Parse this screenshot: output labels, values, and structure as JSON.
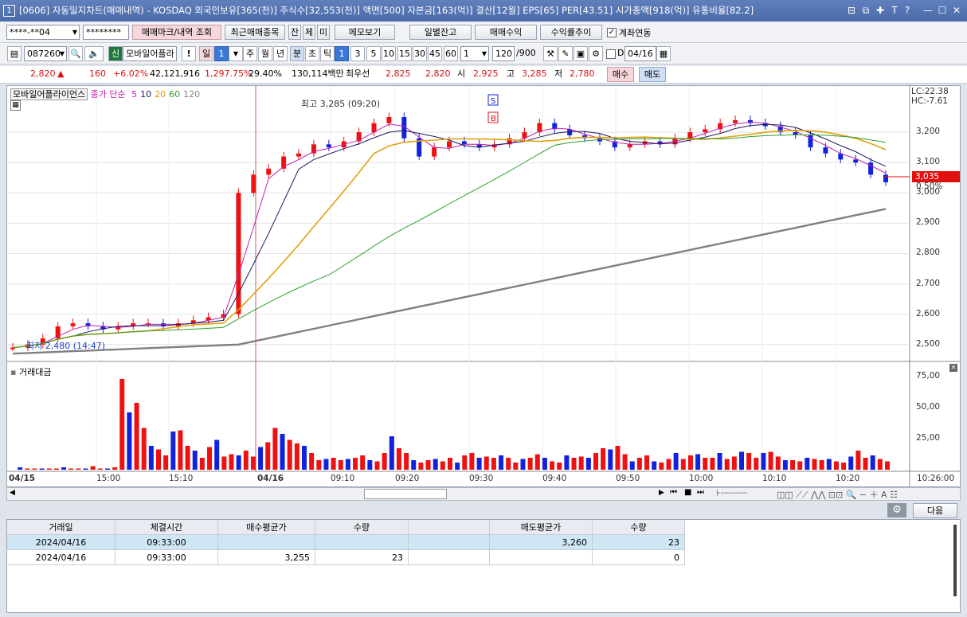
{
  "window": {
    "title": "[0606] 자동일지차트(매매내역) - KOSDAQ 외국인보유[365(천)] 주식수[32,553(천)] 액면[500] 자본금[163(억)] 결산[12월] EPS[65] PER[43.51] 시가총액[918(억)] 유통비율[82.2]",
    "number": "1"
  },
  "toolbar1": {
    "account": "****-**04",
    "password": "********",
    "btn_mark": "매매마크/내역 조회",
    "btn_recent": "최근매매종목",
    "btn_jan": "잔",
    "btn_che": "체",
    "btn_mi": "미",
    "btn_memo": "메모보기",
    "btn_daily": "일별잔고",
    "btn_profit": "매매수익",
    "btn_rate": "수익률추이",
    "account_link": "계좌연동"
  },
  "toolbar2": {
    "code": "087260",
    "shin": "신",
    "name": "모바일어플라",
    "period_day": "일",
    "period_val": "1",
    "week": "주",
    "month": "월",
    "year": "년",
    "minute": "분",
    "cho": "초",
    "tick": "틱",
    "intervals": [
      "1",
      "3",
      "5",
      "10",
      "15",
      "30",
      "45",
      "60"
    ],
    "interval_sel": "1",
    "count": "120",
    "count_max": "/900",
    "d_label": "D",
    "date": "04/16"
  },
  "quote": {
    "price": "2,820",
    "arrow": "▲",
    "change": "160",
    "pct": "+6.02%",
    "volume": "42,121,916",
    "amount": "1,297.75%",
    "ratio": "29.40%",
    "value": "130,114백만",
    "best_label": "최우선",
    "ask": "2,825",
    "bid": "2,820",
    "open_label": "시",
    "open": "2,925",
    "high_label": "고",
    "high": "3,285",
    "low_label": "저",
    "low": "2,780",
    "buy": "매수",
    "sell": "매도"
  },
  "chart": {
    "legend_name": "모바일어플라이언스",
    "legend_ma": "종가 단순",
    "ma": [
      "5",
      "10",
      "20",
      "60",
      "120"
    ],
    "ma_colors": [
      "#c020b0",
      "#1a1a60",
      "#e0a010",
      "#30a030",
      "#808080"
    ],
    "high_label": "최고 3,285 (09:20)",
    "low_label": "최저 2,480 (14:47)",
    "lc": "LC:22.38",
    "hc": "HC:-7.61",
    "cur_price": "3,035",
    "cur_pct": "0.50%",
    "marker_s": "S",
    "marker_b": "B",
    "y_ticks": [
      "3,200",
      "3,100",
      "3,000",
      "2,900",
      "2,800",
      "2,700",
      "2,600",
      "2,500"
    ],
    "vol_label": "거래대금",
    "vol_ticks": [
      "75,00",
      "50,00",
      "25,00"
    ],
    "x_ticks": [
      "04/15",
      "15:00",
      "15:10",
      "04/16",
      "09:10",
      "09:20",
      "09:30",
      "09:40",
      "09:50",
      "10:00",
      "10:10",
      "10:20",
      "10:26:00"
    ]
  },
  "chart_data": {
    "type": "candlestick",
    "y_range": [
      2460,
      3300
    ],
    "vol_range": [
      0,
      80
    ],
    "closes": [
      2490,
      2500,
      2520,
      2560,
      2570,
      2560,
      2550,
      2560,
      2570,
      2570,
      2560,
      2570,
      2580,
      2590,
      2600,
      3000,
      3060,
      3080,
      3120,
      3130,
      3160,
      3150,
      3170,
      3200,
      3230,
      3250,
      3180,
      3120,
      3150,
      3170,
      3160,
      3150,
      3160,
      3180,
      3200,
      3230,
      3210,
      3190,
      3180,
      3170,
      3150,
      3160,
      3170,
      3160,
      3180,
      3200,
      3210,
      3230,
      3240,
      3230,
      3220,
      3200,
      3190,
      3150,
      3130,
      3110,
      3100,
      3060,
      3035
    ],
    "volumes": [
      0,
      2,
      1,
      1,
      1,
      1,
      1,
      2,
      1,
      1,
      1,
      3,
      1,
      1,
      2,
      76,
      48,
      56,
      35,
      20,
      17,
      12,
      32,
      33,
      20,
      16,
      10,
      19,
      25,
      11,
      13,
      12,
      16,
      11,
      19,
      23,
      35,
      30,
      25,
      22,
      20,
      14,
      8,
      9,
      10,
      8,
      9,
      10,
      12,
      8,
      7,
      14,
      28,
      18,
      14,
      8,
      6,
      8,
      9,
      7,
      10,
      6,
      12,
      14,
      10,
      11,
      10,
      12,
      10,
      6,
      9,
      10,
      13,
      10,
      7,
      6,
      12,
      10,
      11,
      10,
      14,
      18,
      17,
      20,
      13,
      7,
      10,
      12,
      7,
      6,
      9,
      14,
      9,
      12,
      13,
      10,
      10,
      14,
      9,
      11,
      15,
      14,
      10,
      14,
      15,
      11,
      8,
      8,
      7,
      10,
      9,
      8,
      9,
      7,
      6,
      11,
      16,
      10,
      12,
      9,
      7
    ]
  },
  "table": {
    "headers": [
      "거래일",
      "체결시간",
      "매수평균가",
      "수량",
      "",
      "매도평균가",
      "수량"
    ],
    "rows": [
      [
        "2024/04/16",
        "09:33:00",
        "",
        "",
        "",
        "3,260",
        "23"
      ],
      [
        "2024/04/16",
        "09:33:00",
        "3,255",
        "23",
        "",
        "",
        "0"
      ]
    ],
    "next": "다음"
  }
}
